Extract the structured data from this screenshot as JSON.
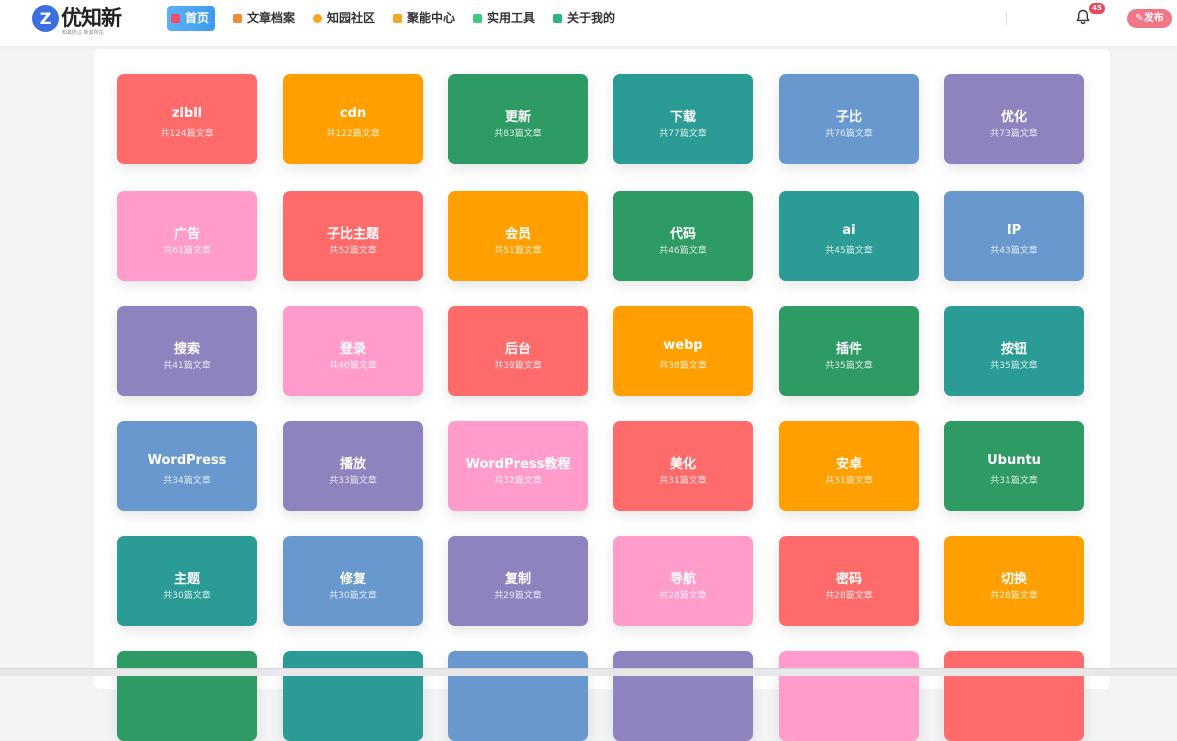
{
  "header": {
    "logo_text": "优知新",
    "logo_mark": "Z",
    "logo_tagline": "知其所以 新其所在",
    "nav": [
      {
        "label": "首页",
        "active": true,
        "icon": "home-icon",
        "color": "#f04d6b"
      },
      {
        "label": "文章档案",
        "active": false,
        "icon": "archive-icon",
        "color": "#f28c38"
      },
      {
        "label": "知园社区",
        "active": false,
        "icon": "chat-icon",
        "color": "#f5a623"
      },
      {
        "label": "聚能中心",
        "active": false,
        "icon": "shield-icon",
        "color": "#f5a623"
      },
      {
        "label": "实用工具",
        "active": false,
        "icon": "grid-icon",
        "color": "#3ec97b"
      },
      {
        "label": "关于我的",
        "active": false,
        "icon": "book-icon",
        "color": "#2cb67d"
      }
    ],
    "notification_count": "45",
    "publish_label": "发布"
  },
  "colors": {
    "red": "#ff6b6b",
    "orange": "#ff9f00",
    "green": "#2e9a64",
    "teal": "#2a9b95",
    "blue": "#6898ce",
    "purple": "#8f83bf",
    "pink": "#ff9ccb"
  },
  "categories": [
    {
      "name": "zibll",
      "count": "共124篇文章",
      "color": "red"
    },
    {
      "name": "cdn",
      "count": "共122篇文章",
      "color": "orange"
    },
    {
      "name": "更新",
      "count": "共83篇文章",
      "color": "green"
    },
    {
      "name": "下载",
      "count": "共77篇文章",
      "color": "teal"
    },
    {
      "name": "子比",
      "count": "共76篇文章",
      "color": "blue"
    },
    {
      "name": "优化",
      "count": "共73篇文章",
      "color": "purple"
    },
    {
      "name": "广告",
      "count": "共61篇文章",
      "color": "pink"
    },
    {
      "name": "子比主题",
      "count": "共52篇文章",
      "color": "red"
    },
    {
      "name": "会员",
      "count": "共51篇文章",
      "color": "orange"
    },
    {
      "name": "代码",
      "count": "共46篇文章",
      "color": "green"
    },
    {
      "name": "ai",
      "count": "共45篇文章",
      "color": "teal"
    },
    {
      "name": "IP",
      "count": "共43篇文章",
      "color": "blue"
    },
    {
      "name": "搜索",
      "count": "共41篇文章",
      "color": "purple"
    },
    {
      "name": "登录",
      "count": "共40篇文章",
      "color": "pink"
    },
    {
      "name": "后台",
      "count": "共39篇文章",
      "color": "red"
    },
    {
      "name": "webp",
      "count": "共38篇文章",
      "color": "orange"
    },
    {
      "name": "插件",
      "count": "共35篇文章",
      "color": "green"
    },
    {
      "name": "按钮",
      "count": "共35篇文章",
      "color": "teal"
    },
    {
      "name": "WordPress",
      "count": "共34篇文章",
      "color": "blue"
    },
    {
      "name": "播放",
      "count": "共33篇文章",
      "color": "purple"
    },
    {
      "name": "WordPress教程",
      "count": "共32篇文章",
      "color": "pink"
    },
    {
      "name": "美化",
      "count": "共31篇文章",
      "color": "red"
    },
    {
      "name": "安卓",
      "count": "共31篇文章",
      "color": "orange"
    },
    {
      "name": "Ubuntu",
      "count": "共31篇文章",
      "color": "green"
    },
    {
      "name": "主题",
      "count": "共30篇文章",
      "color": "teal"
    },
    {
      "name": "修复",
      "count": "共30篇文章",
      "color": "blue"
    },
    {
      "name": "复制",
      "count": "共29篇文章",
      "color": "purple"
    },
    {
      "name": "导航",
      "count": "共28篇文章",
      "color": "pink"
    },
    {
      "name": "密码",
      "count": "共28篇文章",
      "color": "red"
    },
    {
      "name": "切换",
      "count": "共28篇文章",
      "color": "orange"
    },
    {
      "name": "",
      "count": "",
      "color": "green"
    },
    {
      "name": "",
      "count": "",
      "color": "teal"
    },
    {
      "name": "",
      "count": "",
      "color": "blue"
    },
    {
      "name": "",
      "count": "",
      "color": "purple"
    },
    {
      "name": "",
      "count": "",
      "color": "pink"
    },
    {
      "name": "",
      "count": "",
      "color": "red"
    }
  ]
}
